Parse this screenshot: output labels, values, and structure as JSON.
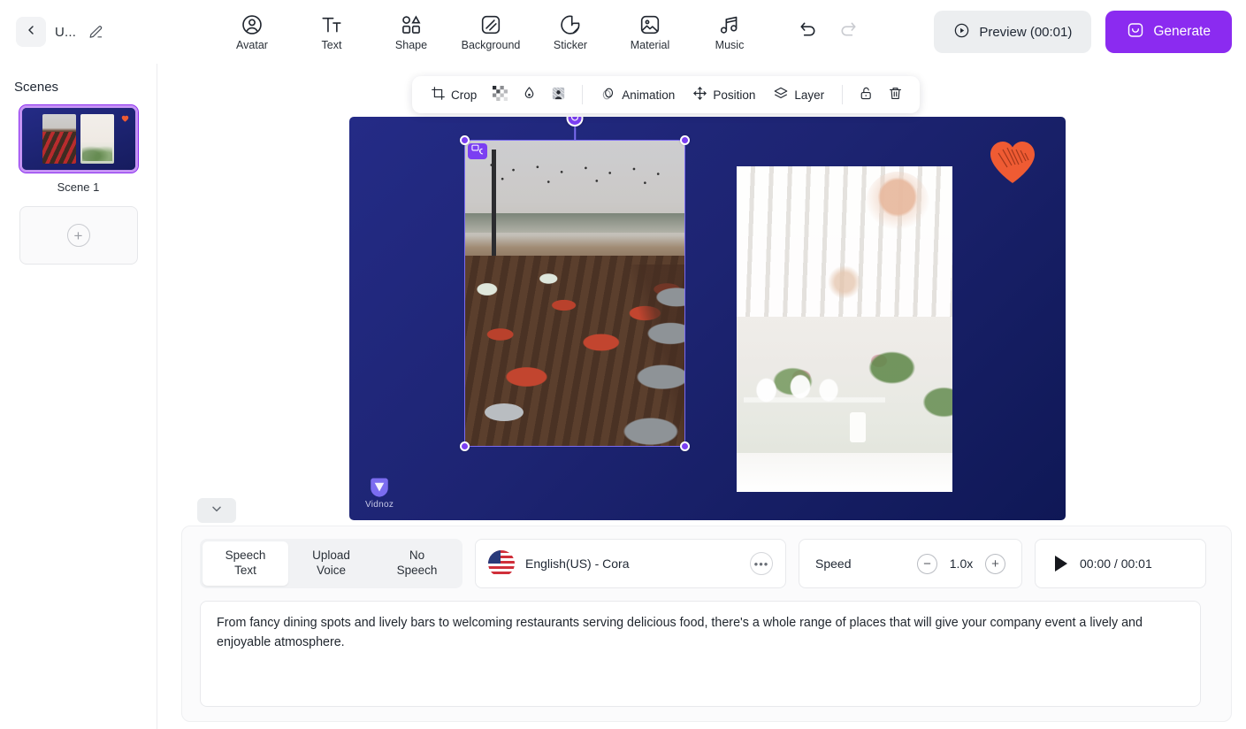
{
  "header": {
    "back_icon": "chevron-left-icon",
    "project_title": "U...",
    "edit_icon": "pencil-icon",
    "tools": [
      {
        "label": "Avatar",
        "icon": "avatar-icon"
      },
      {
        "label": "Text",
        "icon": "text-icon"
      },
      {
        "label": "Shape",
        "icon": "shape-icon"
      },
      {
        "label": "Background",
        "icon": "background-icon"
      },
      {
        "label": "Sticker",
        "icon": "sticker-icon"
      },
      {
        "label": "Material",
        "icon": "material-icon"
      },
      {
        "label": "Music",
        "icon": "music-icon"
      }
    ],
    "undo_icon": "undo-icon",
    "redo_icon": "redo-icon",
    "preview_label": "Preview (00:01)",
    "preview_icon": "play-circle-icon",
    "generate_label": "Generate",
    "generate_icon": "generate-icon",
    "generate_color": "#8b2bf0"
  },
  "sidebar": {
    "title": "Scenes",
    "scene": {
      "name": "Scene 1",
      "selected": true
    },
    "add_scene_icon": "plus-icon"
  },
  "object_toolbar": {
    "items": [
      {
        "label": "Crop",
        "icon": "crop-icon"
      },
      {
        "label": "",
        "icon": "transparency-grid-icon"
      },
      {
        "label": "",
        "icon": "water-drop-icon"
      },
      {
        "label": "",
        "icon": "remove-background-icon"
      },
      {
        "label": "Animation",
        "icon": "animation-icon"
      },
      {
        "label": "Position",
        "icon": "position-icon"
      },
      {
        "label": "Layer",
        "icon": "layer-icon"
      },
      {
        "label": "",
        "icon": "unlock-icon"
      },
      {
        "label": "",
        "icon": "trash-icon"
      }
    ]
  },
  "canvas": {
    "background_color": "#1d2472",
    "watermark_text": "Vidnoz",
    "sticker": "heart-sticker",
    "sticker_color": "#ef5b33",
    "selection_color": "#7b3ff2",
    "replace_image_icon": "replace-image-icon",
    "rotate_icon": "rotate-icon",
    "collapse_icon": "chevron-down-icon"
  },
  "audio_panel": {
    "tabs": [
      {
        "line1": "Speech",
        "line2": "Text",
        "active": true
      },
      {
        "line1": "Upload",
        "line2": "Voice",
        "active": false
      },
      {
        "line1": "No",
        "line2": "Speech",
        "active": false
      }
    ],
    "voice": {
      "flag": "us-flag-icon",
      "name": "English(US) - Cora",
      "more_icon": "more-options-icon"
    },
    "speed": {
      "label": "Speed",
      "value": "1.0x",
      "decrease_icon": "minus-icon",
      "increase_icon": "plus-icon"
    },
    "playback": {
      "play_icon": "play-icon",
      "time": "00:00 / 00:01"
    },
    "script": "From fancy dining spots and lively bars to welcoming restaurants serving delicious food, there's a whole range of places that will give your company event a lively and enjoyable atmosphere."
  }
}
